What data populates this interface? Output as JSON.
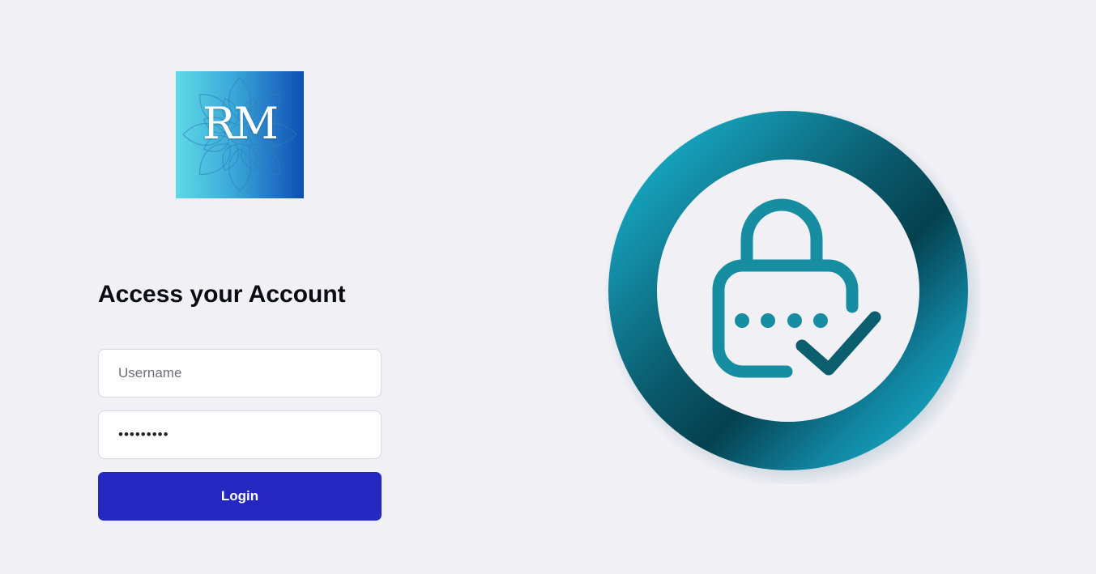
{
  "logo": {
    "text": "RM",
    "icon": "rm-logo-mandala"
  },
  "login_form": {
    "heading": "Access your Account",
    "username": {
      "placeholder": "Username",
      "value": ""
    },
    "password": {
      "value": "•••••••••"
    },
    "login_button": "Login"
  },
  "illustration": {
    "icon": "lock-check-icon"
  },
  "colors": {
    "background": "#f0f0f5",
    "button": "#2428c0",
    "ring_teal": "#18a4bd",
    "ring_dark": "#064050",
    "icon_teal": "#1a8ea3"
  }
}
